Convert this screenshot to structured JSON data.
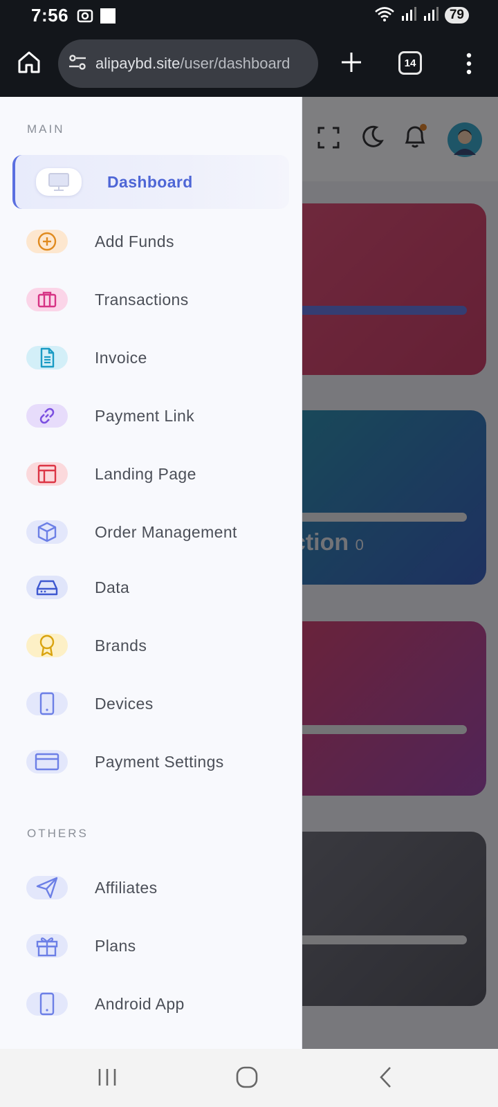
{
  "status_bar": {
    "time": "7:56",
    "battery": "79"
  },
  "browser": {
    "url_host": "alipaybd.site",
    "url_path": "/user/dashboard",
    "tab_count": "14"
  },
  "background": {
    "card_fragment_text": "action",
    "card_fragment_count": "0"
  },
  "sidebar": {
    "main_label": "MAIN",
    "others_label": "OTHERS",
    "main_items": [
      {
        "label": "Dashboard",
        "icon": "monitor-icon",
        "color": "#5b6fe0",
        "tint": "#ffffff"
      },
      {
        "label": "Add Funds",
        "icon": "plus-circle-icon",
        "color": "#e08a1e",
        "tint": "#fde7cf"
      },
      {
        "label": "Transactions",
        "icon": "briefcase-icon",
        "color": "#d63384",
        "tint": "#fbd5e8"
      },
      {
        "label": "Invoice",
        "icon": "document-icon",
        "color": "#1a9bc4",
        "tint": "#d3eff8"
      },
      {
        "label": "Payment Link",
        "icon": "link-icon",
        "color": "#7b4fe0",
        "tint": "#e7dcfb"
      },
      {
        "label": "Landing Page",
        "icon": "layout-icon",
        "color": "#dc3545",
        "tint": "#fbd9dc"
      },
      {
        "label": "Order Management",
        "icon": "box-icon",
        "color": "#6c7fe6",
        "tint": "#e3e7fb"
      },
      {
        "label": "Data",
        "icon": "drive-icon",
        "color": "#3e58d0",
        "tint": "#e0e5fa"
      },
      {
        "label": "Brands",
        "icon": "award-icon",
        "color": "#d9a30e",
        "tint": "#fdf0c6"
      },
      {
        "label": "Devices",
        "icon": "tablet-icon",
        "color": "#6c7fe6",
        "tint": "#e3e7fb"
      },
      {
        "label": "Payment Settings",
        "icon": "card-icon",
        "color": "#6c7fe6",
        "tint": "#e3e7fb"
      }
    ],
    "other_items": [
      {
        "label": "Affiliates",
        "icon": "send-icon",
        "color": "#6c7fe6",
        "tint": "#e3e7fb"
      },
      {
        "label": "Plans",
        "icon": "gift-icon",
        "color": "#6c7fe6",
        "tint": "#e3e7fb"
      },
      {
        "label": "Android App",
        "icon": "phone-icon",
        "color": "#6c7fe6",
        "tint": "#e3e7fb"
      }
    ]
  }
}
